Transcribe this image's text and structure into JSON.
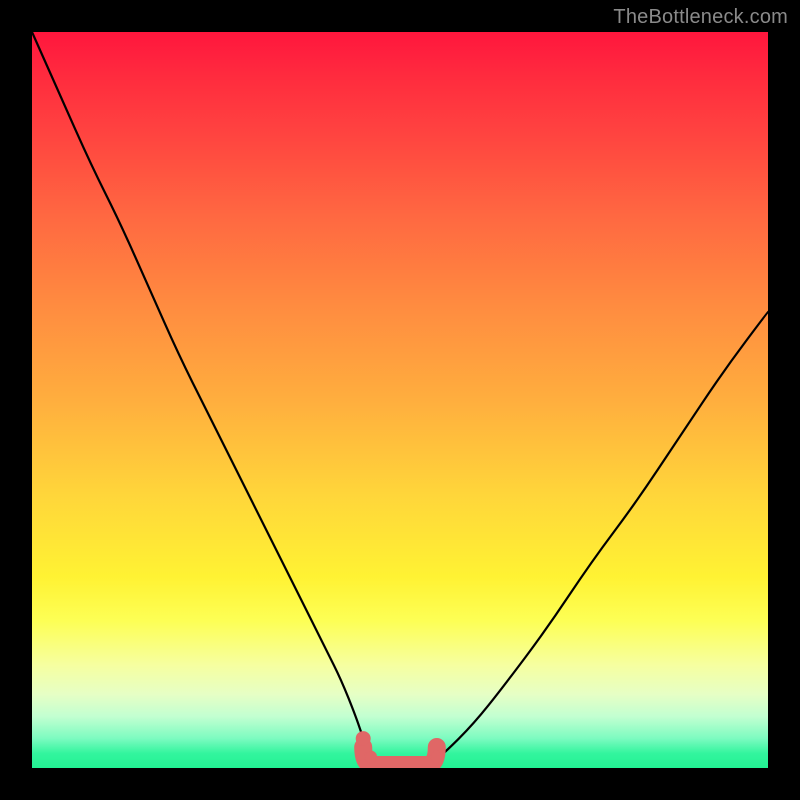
{
  "watermark": "TheBottleneck.com",
  "colors": {
    "curve_stroke": "#000000",
    "marker_fill": "#e06766",
    "marker_stroke": "#e06766",
    "basin_stroke": "#e06766",
    "basin_stroke_width": 18
  },
  "chart_data": {
    "type": "line",
    "title": "",
    "xlabel": "",
    "ylabel": "",
    "xlim": [
      0,
      100
    ],
    "ylim": [
      0,
      100
    ],
    "grid": false,
    "legend": false,
    "annotations": [],
    "series": [
      {
        "name": "bottleneck-curve",
        "x": [
          0,
          4,
          8,
          12,
          16,
          20,
          24,
          28,
          32,
          36,
          40,
          42,
          44,
          45,
          46,
          47,
          48,
          50,
          52,
          54,
          56,
          60,
          64,
          70,
          76,
          82,
          88,
          94,
          100
        ],
        "y": [
          100,
          91,
          82,
          74,
          65,
          56,
          48,
          40,
          32,
          24,
          16,
          12,
          7,
          4,
          2,
          0.5,
          0,
          0,
          0,
          0.5,
          2,
          6,
          11,
          19,
          28,
          36,
          45,
          54,
          62
        ]
      }
    ],
    "basin": {
      "x_start": 45,
      "x_end": 55,
      "y": 0
    },
    "markers": [
      {
        "x": 45.0,
        "y": 4.0,
        "r": 7
      },
      {
        "x": 46.0,
        "y": 1.5,
        "r": 6
      },
      {
        "x": 55.0,
        "y": 1.5,
        "r": 6
      }
    ]
  }
}
